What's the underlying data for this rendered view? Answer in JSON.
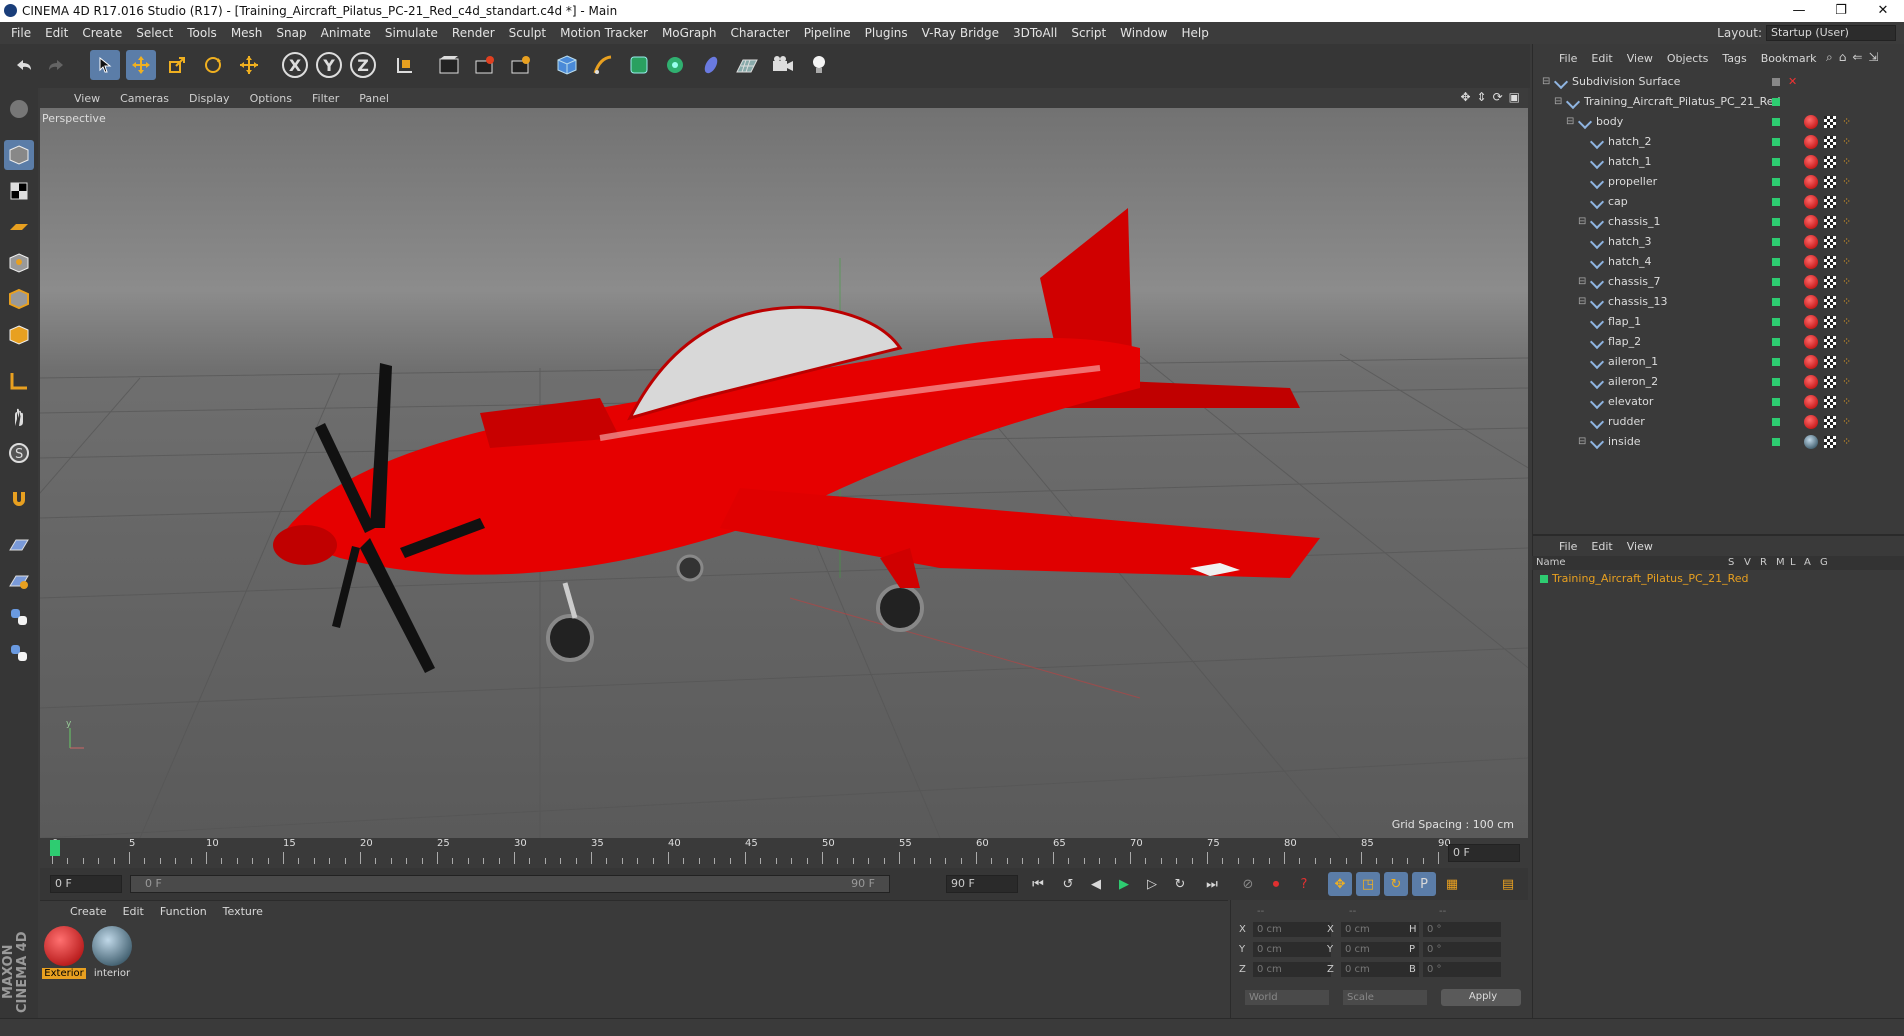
{
  "window": {
    "title": "CINEMA 4D R17.016 Studio (R17) - [Training_Aircraft_Pilatus_PC-21_Red_c4d_standart.c4d *] - Main",
    "controls": [
      "—",
      "❐",
      "✕"
    ]
  },
  "menu": [
    "File",
    "Edit",
    "Create",
    "Select",
    "Tools",
    "Mesh",
    "Snap",
    "Animate",
    "Simulate",
    "Render",
    "Sculpt",
    "Motion Tracker",
    "MoGraph",
    "Character",
    "Pipeline",
    "Plugins",
    "V-Ray Bridge",
    "3DToAll",
    "Script",
    "Window",
    "Help"
  ],
  "layout": {
    "label": "Layout:",
    "value": "Startup (User)"
  },
  "toolbar": {
    "icons": [
      "undo-icon",
      "redo-icon",
      "select-icon",
      "move-icon",
      "scale-icon",
      "rotate-icon",
      "transform-icon",
      "x-axis-icon",
      "y-axis-icon",
      "z-axis-icon",
      "coord-icon",
      "render-view-icon",
      "render-picture-icon",
      "edit-render-icon",
      "cube-icon",
      "pen-icon",
      "subdivide-icon",
      "cloner-icon",
      "deformer-icon",
      "floor-icon",
      "camera-icon",
      "light-icon"
    ],
    "axis": [
      "X",
      "Y",
      "Z"
    ]
  },
  "viewport": {
    "menu": [
      "View",
      "Cameras",
      "Display",
      "Options",
      "Filter",
      "Panel"
    ],
    "label": "Perspective",
    "grid_spacing": "Grid Spacing : 100 cm"
  },
  "timeline": {
    "ticks": [
      "0",
      "5",
      "10",
      "15",
      "20",
      "25",
      "30",
      "35",
      "40",
      "45",
      "50",
      "55",
      "60",
      "65",
      "70",
      "75",
      "80",
      "85",
      "90"
    ],
    "current_frame": "0 F",
    "start": "0 F",
    "range_start": "0 F",
    "range_end": "90 F",
    "end": "90 F"
  },
  "materials": {
    "menu": [
      "Create",
      "Edit",
      "Function",
      "Texture"
    ],
    "items": [
      {
        "label": "Exterior",
        "selected": true
      },
      {
        "label": "interior",
        "selected": false
      }
    ]
  },
  "coords": {
    "headers": [
      "--",
      "--",
      "--"
    ],
    "rows": [
      {
        "a": "X",
        "av": "0 cm",
        "b": "X",
        "bv": "0 cm",
        "c": "H",
        "cv": "0 °"
      },
      {
        "a": "Y",
        "av": "0 cm",
        "b": "Y",
        "bv": "0 cm",
        "c": "P",
        "cv": "0 °"
      },
      {
        "a": "Z",
        "av": "0 cm",
        "b": "Z",
        "bv": "0 cm",
        "c": "B",
        "cv": "0 °"
      }
    ],
    "world": "World",
    "scale": "Scale",
    "apply": "Apply"
  },
  "objects": {
    "menu": [
      "File",
      "Edit",
      "View",
      "Objects",
      "Tags",
      "Bookmark"
    ],
    "items": [
      "Subdivision Surface",
      "Training_Aircraft_Pilatus_PC_21_Red",
      "body",
      "hatch_2",
      "hatch_1",
      "propeller",
      "cap",
      "chassis_1",
      "hatch_3",
      "hatch_4",
      "chassis_7",
      "chassis_13",
      "flap_1",
      "flap_2",
      "aileron_1",
      "aileron_2",
      "elevator",
      "rudder",
      "inside"
    ]
  },
  "attributes": {
    "menu": [
      "File",
      "Edit",
      "View"
    ],
    "columns": [
      "Name",
      "S",
      "V",
      "R",
      "M",
      "L",
      "A",
      "G"
    ],
    "row": "Training_Aircraft_Pilatus_PC_21_Red"
  },
  "branding": "MAXON CINEMA 4D",
  "colors": {
    "accent": "#5b7da8",
    "plane": "#e00000",
    "green": "#2ecc71",
    "orange": "#e8a020"
  }
}
